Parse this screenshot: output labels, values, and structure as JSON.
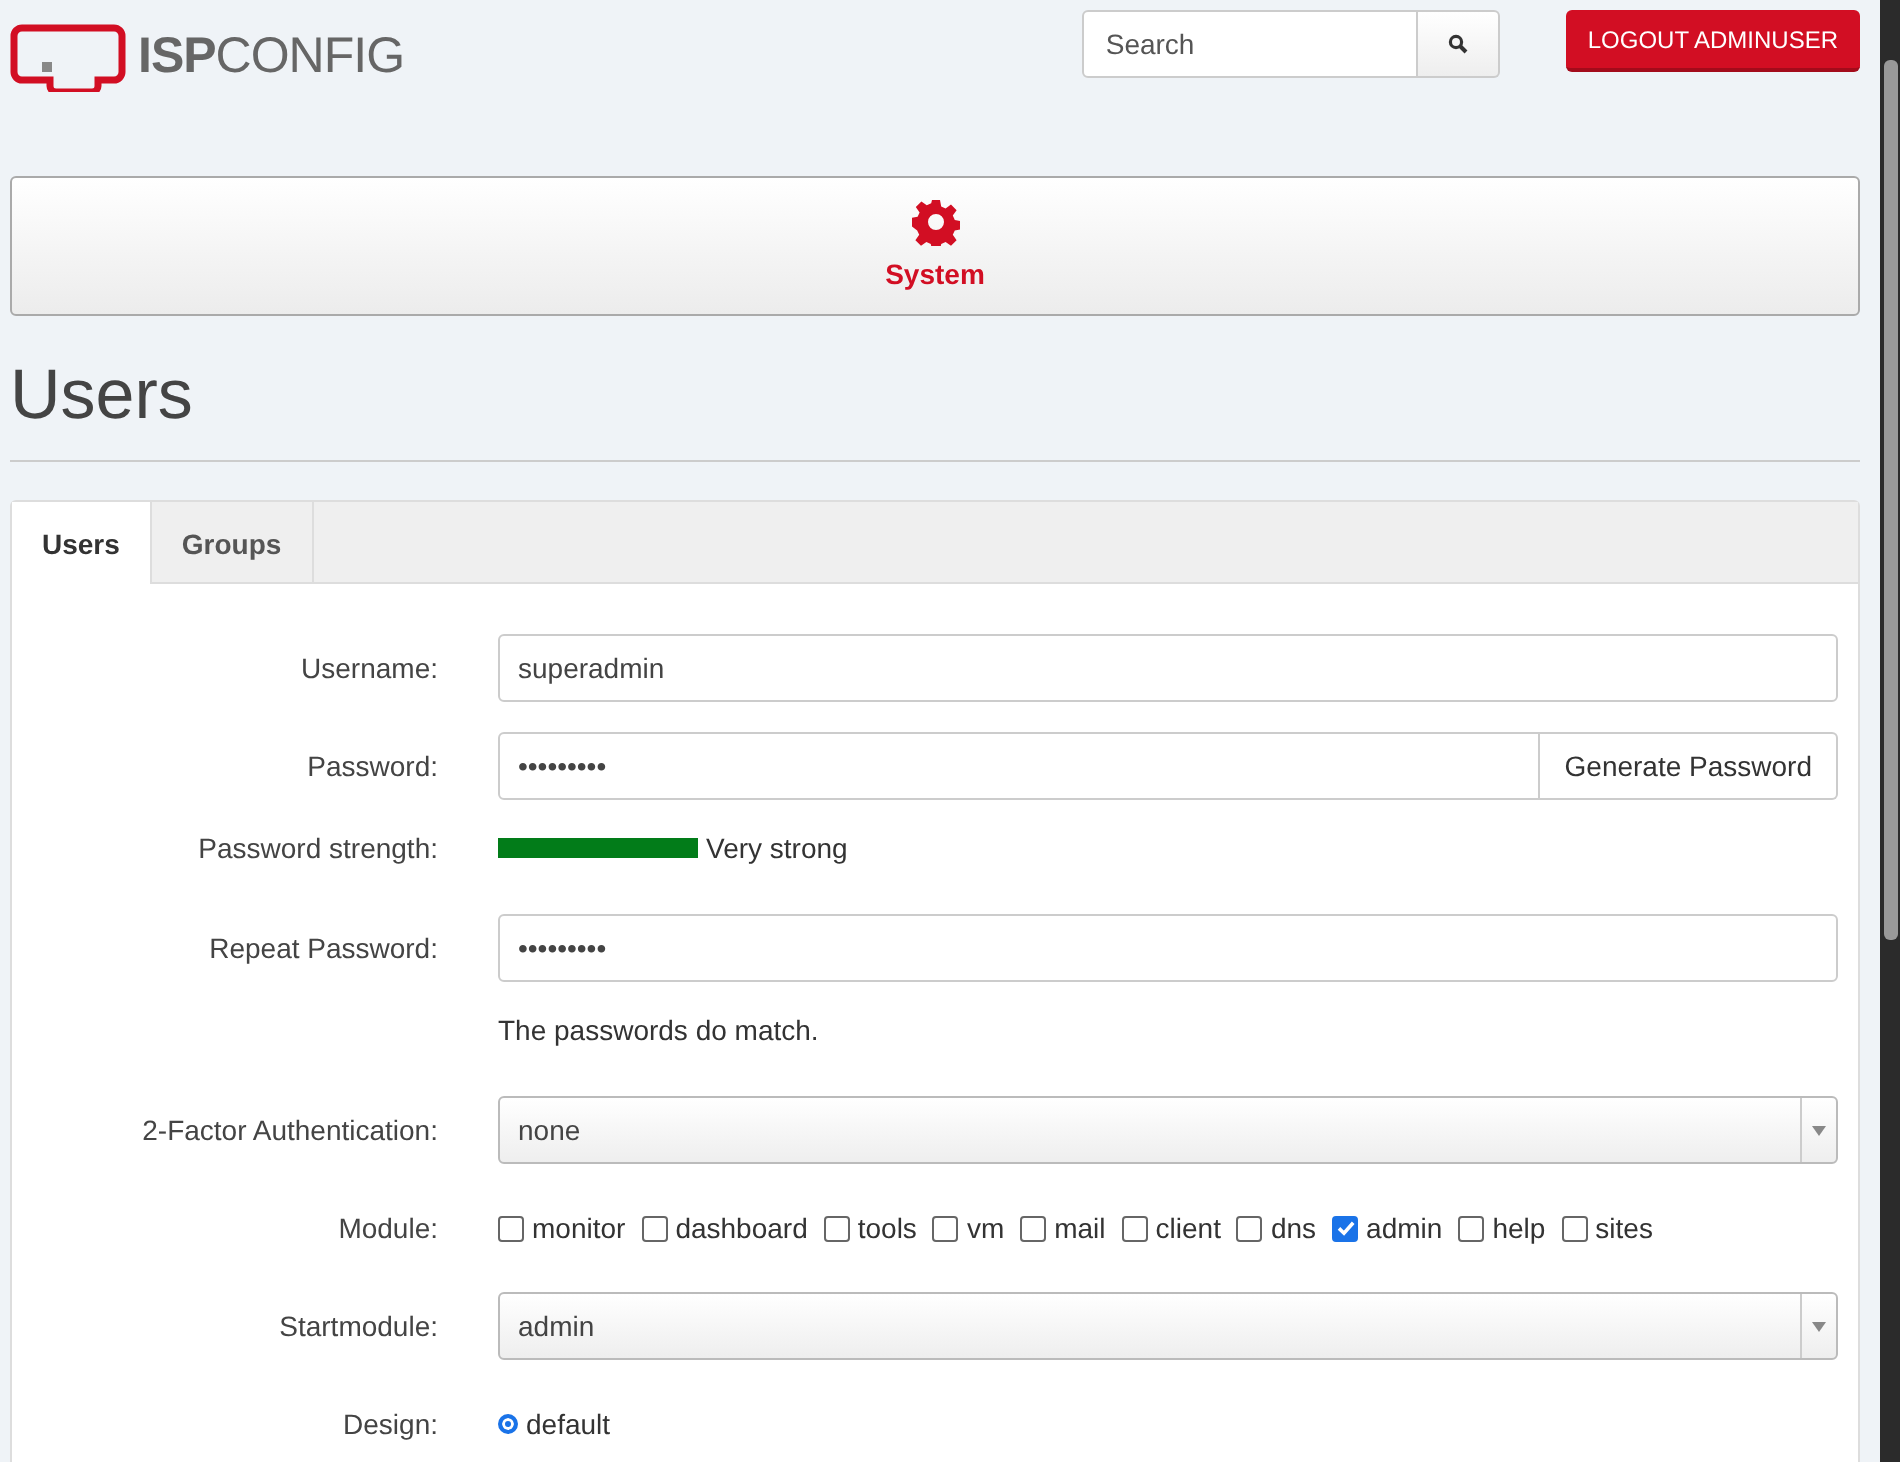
{
  "header": {
    "logo": "**ISP**CONFIG",
    "search": {
      "placeholder": "Search"
    },
    "logout": "LOGOUT ADMINUSER"
  },
  "module_nav": [
    {
      "label": "System",
      "selected": true
    }
  ],
  "page_title": "Users",
  "tabs": [
    {
      "label": "Users",
      "selected": true
    },
    {
      "label": "Groups",
      "selected": false
    }
  ],
  "form": [
    {
      "kind": "text",
      "label": "Username:",
      "value": "superadmin"
    },
    {
      "kind": "password",
      "label": "Password:",
      "value": "•••••••••",
      "button": "Generate Password"
    },
    {
      "kind": "strength",
      "label": "Password strength:",
      "level": 1,
      "reading": "Very strong"
    },
    {
      "kind": "text",
      "label": "Repeat Password:",
      "value": "•••••••••"
    },
    {
      "kind": "note",
      "text": "The passwords do match."
    },
    {
      "kind": "select",
      "label": "2-Factor Authentication:",
      "value": "none"
    },
    {
      "kind": "checks",
      "label": "Module:",
      "options": [
        {
          "label": "monitor",
          "checked": false
        },
        {
          "label": "dashboard",
          "checked": false
        },
        {
          "label": "tools",
          "checked": false
        },
        {
          "label": "vm",
          "checked": false
        },
        {
          "label": "mail",
          "checked": false
        },
        {
          "label": "client",
          "checked": false
        },
        {
          "label": "dns",
          "checked": false
        },
        {
          "label": "admin",
          "checked": true
        },
        {
          "label": "help",
          "checked": false
        },
        {
          "label": "sites",
          "checked": false
        }
      ]
    },
    {
      "kind": "select",
      "label": "Startmodule:",
      "value": "admin"
    },
    {
      "kind": "radios",
      "label": "Design:",
      "options": [
        {
          "label": "default",
          "selected": true
        }
      ]
    }
  ]
}
